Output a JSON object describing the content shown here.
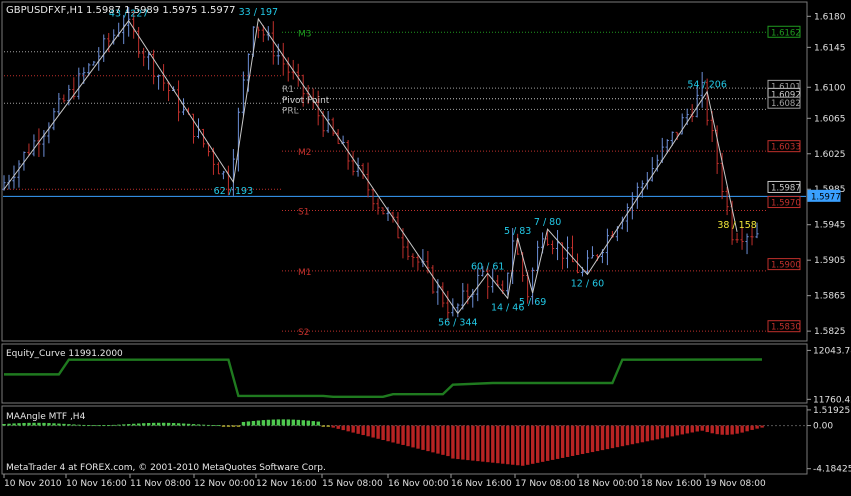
{
  "header": {
    "symbol": "GBPUSDFXF,H1",
    "ohlc": "1.5987 1.5989 1.5975 1.5977"
  },
  "footer": "MetaTrader 4 at FOREX.com, © 2001-2010 MetaQuotes Software Corp.",
  "colors": {
    "background": "#000000",
    "bull_bar": "#6d8fd6",
    "bear_bar": "#c0302c",
    "zigzag": "#c8c8c8",
    "zigzag_label": "#22c8e6",
    "current_price": "#3aa0ff",
    "equity_line": "#1f7a1f",
    "hist_green": "#4fc94f",
    "hist_yellow": "#f0e53a",
    "hist_red": "#b82323"
  },
  "chart_data": [
    {
      "type": "line",
      "panel": "main",
      "y_ticks": [
        1.618,
        1.6145,
        1.61,
        1.6065,
        1.6025,
        1.5985,
        1.5945,
        1.5905,
        1.5865,
        1.5825
      ],
      "ylim": [
        1.5815,
        1.6195
      ],
      "x_labels": [
        "10 Nov 2010",
        "10 Nov 16:00",
        "11 Nov 08:00",
        "12 Nov 00:00",
        "12 Nov 16:00",
        "15 Nov 08:00",
        "16 Nov 00:00",
        "16 Nov 16:00",
        "17 Nov 08:00",
        "18 Nov 00:00",
        "18 Nov 16:00",
        "19 Nov 08:00"
      ],
      "current_price": 1.5977,
      "price_boxes": [
        {
          "label": "1.6162",
          "value": 1.6162,
          "color": "#1f9a1f"
        },
        {
          "label": "1.6101",
          "value": 1.6101,
          "color": "#a0a0a0"
        },
        {
          "label": "1.6092",
          "value": 1.6092,
          "color": "#c8c8c8"
        },
        {
          "label": "1.6082",
          "value": 1.6082,
          "color": "#a0a0a0"
        },
        {
          "label": "1.6033",
          "value": 1.6033,
          "color": "#c0302c"
        },
        {
          "label": "1.5987",
          "value": 1.5987,
          "color": "#c8c8c8"
        },
        {
          "label": "1.5970",
          "value": 1.597,
          "color": "#c0302c"
        },
        {
          "label": "1.5900",
          "value": 1.59,
          "color": "#c0302c"
        },
        {
          "label": "1.5830",
          "value": 1.583,
          "color": "#c0302c"
        },
        {
          "label": "1.5977",
          "value": 1.5977,
          "color": "#3aa0ff"
        }
      ],
      "pivot_levels": [
        {
          "name": "M3",
          "value": 1.6162,
          "color": "#1f9a1f"
        },
        {
          "name": "R1",
          "value": 1.6099,
          "color": "#a0a0a0"
        },
        {
          "name": "Pivot Point",
          "value": 1.6087,
          "color": "#c8c8c8"
        },
        {
          "name": "PRL",
          "value": 1.6075,
          "color": "#a0a0a0"
        },
        {
          "name": "M2",
          "value": 1.6028,
          "color": "#c0302c"
        },
        {
          "name": "S1",
          "value": 1.5961,
          "color": "#c0302c"
        },
        {
          "name": "M1",
          "value": 1.5893,
          "color": "#c0302c"
        },
        {
          "name": "S2",
          "value": 1.5825,
          "color": "#c0302c"
        }
      ],
      "zigzag_points": [
        {
          "bar": 0,
          "price": 1.5985,
          "label": ""
        },
        {
          "bar": 25,
          "price": 1.6175,
          "label": "43 / 227"
        },
        {
          "bar": 46,
          "price": 1.5993,
          "label": "62 / 193"
        },
        {
          "bar": 51,
          "price": 1.6177,
          "label": "33 / 197"
        },
        {
          "bar": 91,
          "price": 1.5845,
          "label": "56 / 344"
        },
        {
          "bar": 97,
          "price": 1.589,
          "label": "60 / 61"
        },
        {
          "bar": 101,
          "price": 1.5862,
          "label": "14 / 46"
        },
        {
          "bar": 103,
          "price": 1.593,
          "label": "5 / 83"
        },
        {
          "bar": 106,
          "price": 1.5868,
          "label": "5 / 69"
        },
        {
          "bar": 109,
          "price": 1.594,
          "label": "7 / 80"
        },
        {
          "bar": 117,
          "price": 1.5889,
          "label": "12 / 60"
        },
        {
          "bar": 141,
          "price": 1.6095,
          "label": "54 / 206"
        },
        {
          "bar": 147,
          "price": 1.5937,
          "label": "38 / 158"
        }
      ]
    },
    {
      "type": "line",
      "panel": "equity",
      "title": "Equity_Curve 11991.2000",
      "y_ticks": [
        12043.78,
        11760.42
      ],
      "ylim": [
        11745,
        12075
      ],
      "values": [
        {
          "bar": 0,
          "value": 11905
        },
        {
          "bar": 11,
          "value": 11905
        },
        {
          "bar": 13,
          "value": 11990
        },
        {
          "bar": 45,
          "value": 11990
        },
        {
          "bar": 47,
          "value": 11780
        },
        {
          "bar": 64,
          "value": 11780
        },
        {
          "bar": 66,
          "value": 11775
        },
        {
          "bar": 76,
          "value": 11775
        },
        {
          "bar": 78,
          "value": 11790
        },
        {
          "bar": 88,
          "value": 11790
        },
        {
          "bar": 90,
          "value": 11845
        },
        {
          "bar": 98,
          "value": 11855
        },
        {
          "bar": 122,
          "value": 11855
        },
        {
          "bar": 124,
          "value": 11990
        },
        {
          "bar": 152,
          "value": 11991
        }
      ]
    },
    {
      "type": "bar",
      "panel": "oscillator",
      "title": "MAAngle MTF ,H4",
      "y_ticks": [
        1.51925,
        0.0,
        -4.18425
      ],
      "ylim": [
        -4.6,
        1.8
      ]
    }
  ]
}
